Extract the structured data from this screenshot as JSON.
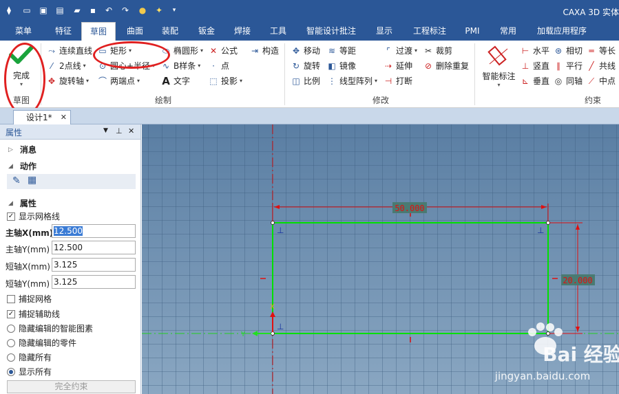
{
  "app": {
    "title": "CAXA 3D 实体"
  },
  "quick_access": [
    "sketch-logo-icon",
    "new-file-icon",
    "open-import-icon",
    "open-file-icon",
    "folder-icon",
    "save-icon",
    "undo-icon",
    "redo-icon",
    "lightbulb-icon",
    "sparkle-icon",
    "customize-dropdown-icon"
  ],
  "tabs": [
    {
      "label": "菜单"
    },
    {
      "label": "特征"
    },
    {
      "label": "草图"
    },
    {
      "label": "曲面"
    },
    {
      "label": "装配"
    },
    {
      "label": "钣金"
    },
    {
      "label": "焊接"
    },
    {
      "label": "工具"
    },
    {
      "label": "智能设计批注"
    },
    {
      "label": "显示"
    },
    {
      "label": "工程标注"
    },
    {
      "label": "PMI"
    },
    {
      "label": "常用"
    },
    {
      "label": "加载应用程序"
    }
  ],
  "ribbon": {
    "finish_label": "完成",
    "groups": {
      "sketch": "草图",
      "draw": "绘制",
      "modify": "修改",
      "constraint": "约束"
    },
    "draw": {
      "polyline": "连续直线",
      "rect": "矩形",
      "ellipse": "椭圆形",
      "formula": "公式",
      "construct": "构造",
      "two_point": "2点线",
      "center_radius": "圆心+半径",
      "bspline": "B样条",
      "point": "点",
      "revolve_axis": "旋转轴",
      "two_end": "两端点",
      "text": "文字",
      "project": "投影"
    },
    "modify": {
      "move": "移动",
      "equidistant": "等距",
      "fillet": "过渡",
      "trim": "裁剪",
      "rotate": "旋转",
      "mirror": "镜像",
      "extend": "延伸",
      "delete_repeat": "删除重复",
      "scale": "比例",
      "linear_array": "线型阵列",
      "break": "打断"
    },
    "constraint": {
      "smart_dim": "智能标注",
      "horizontal": "水平",
      "tangent": "相切",
      "equal": "等长",
      "vertical": "竖直",
      "parallel": "平行",
      "collinear": "共线",
      "perpendicular": "垂直",
      "concentric": "同轴",
      "midpoint": "中点"
    }
  },
  "doc_tab": {
    "label": "设计1*"
  },
  "panel": {
    "title": "属性",
    "message": "消息",
    "action": "动作",
    "properties": "属性",
    "show_grid": "显示网格线",
    "major_x_label": "主轴X(mm)",
    "major_x": "12.500",
    "major_y_label": "主轴Y(mm)",
    "major_y": "12.500",
    "minor_x_label": "短轴X(mm)",
    "minor_x": "3.125",
    "minor_y_label": "短轴Y(mm)",
    "minor_y": "3.125",
    "snap_grid": "捕捉网格",
    "snap_aux": "捕捉辅助线",
    "radio1": "隐藏编辑的智能图素",
    "radio2": "隐藏编辑的零件",
    "radio3": "隐藏所有",
    "radio4": "显示所有",
    "full_constraint": "完全约束"
  },
  "sketch": {
    "dim_width": "50.000",
    "dim_height": "20.000",
    "axis_x": "X",
    "axis_y": "Y"
  },
  "watermark": {
    "brand": "Bai 经验",
    "url": "jingyan.baidu.com"
  },
  "colors": {
    "accent": "#2b5797",
    "sketch_line": "#00e000",
    "dimension": "#e01010",
    "canvas_bg": "#6a8cad"
  }
}
